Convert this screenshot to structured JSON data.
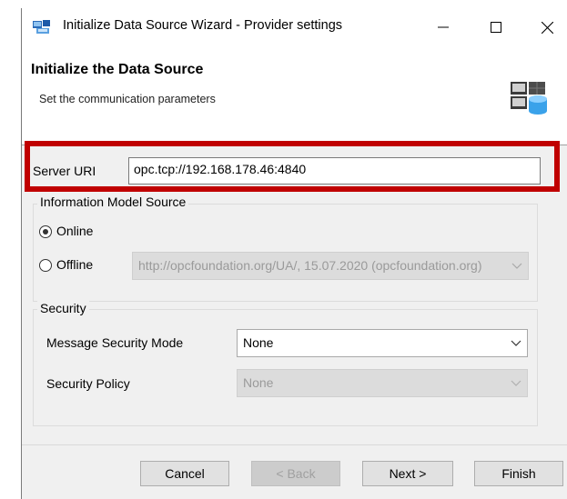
{
  "window": {
    "title": "Initialize Data Source Wizard - Provider settings",
    "controls": {
      "minimize": "minimize",
      "maximize": "maximize",
      "close": "close"
    }
  },
  "header": {
    "title": "Initialize the Data Source",
    "subtitle": "Set the communication parameters"
  },
  "server": {
    "label": "Server URI",
    "value": "opc.tcp://192.168.178.46:4840"
  },
  "info_model": {
    "legend": "Information Model Source",
    "online_label": "Online",
    "offline_label": "Offline",
    "selected": "Online",
    "offline_value": "http://opcfoundation.org/UA/, 15.07.2020 (opcfoundation.org)"
  },
  "security": {
    "legend": "Security",
    "mode_label": "Message Security Mode",
    "mode_value": "None",
    "policy_label": "Security Policy",
    "policy_value": "None"
  },
  "buttons": {
    "cancel": "Cancel",
    "back": "< Back",
    "next": "Next >",
    "finish": "Finish"
  },
  "colors": {
    "highlight": "#c00000",
    "window_bg": "#f0f0f0"
  }
}
